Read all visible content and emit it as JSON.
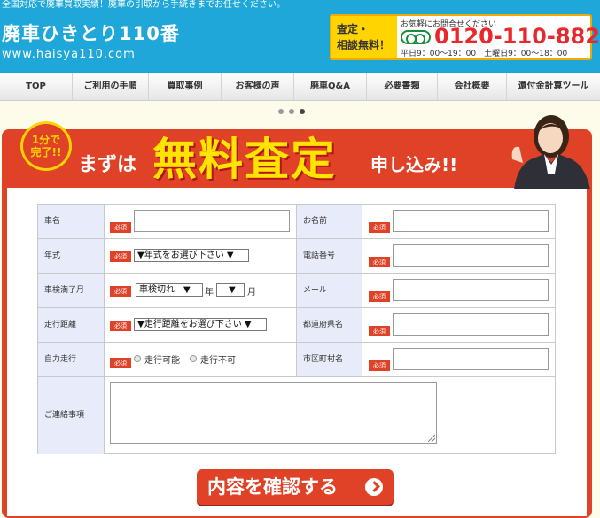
{
  "header": {
    "tagline": "全国対応で廃車買取実績！廃車の引取から手続きまでお任せください。",
    "logo_main": "廃車ひきとり110番",
    "logo_url": "www.haisya110.com",
    "contact": {
      "label_line1": "査定・",
      "label_line2": "相談無料！",
      "ask": "お気軽にお問合せください",
      "phone": "0120-110-882",
      "hours": "平日9：00～19：00　土曜日9：00～18：00"
    }
  },
  "nav": {
    "items": [
      {
        "label": "TOP"
      },
      {
        "label": "ご利用の手順"
      },
      {
        "label": "買取事例"
      },
      {
        "label": "お客様の声"
      },
      {
        "label": "廃車Q&A"
      },
      {
        "label": "必要書類"
      },
      {
        "label": "会社概要"
      },
      {
        "label": "還付金計算ツール"
      }
    ]
  },
  "banner": {
    "badge_line1": "1分で",
    "badge_line2": "完了!!",
    "lead": "まずは",
    "big": "無料査定",
    "tail": "申し込み!!"
  },
  "form": {
    "required": "必須",
    "car_name_label": "車名",
    "year_label": "年式",
    "year_select": "▼年式をお選び下さい ▼",
    "inspection_label": "車検満了月",
    "inspection_select": "車検切れ　▼",
    "year_unit": "年",
    "month_select": "　▼",
    "month_unit": "月",
    "mileage_label": "走行距離",
    "mileage_select": "▼走行距離をお選び下さい ▼",
    "drivable_label": "自力走行",
    "drivable_yes": "走行可能",
    "drivable_no": "走行不可",
    "name_label": "お名前",
    "phone_label": "電話番号",
    "mail_label": "メール",
    "prefecture_label": "都道府県名",
    "city_label": "市区町村名",
    "notes_label": "ご連絡事項",
    "submit_label": "内容を確認する"
  },
  "colors": {
    "header_blue": "#1ea7d8",
    "brand_red": "#e04227",
    "accent_yellow": "#ffd400",
    "label_bg": "#e8ecfa"
  }
}
